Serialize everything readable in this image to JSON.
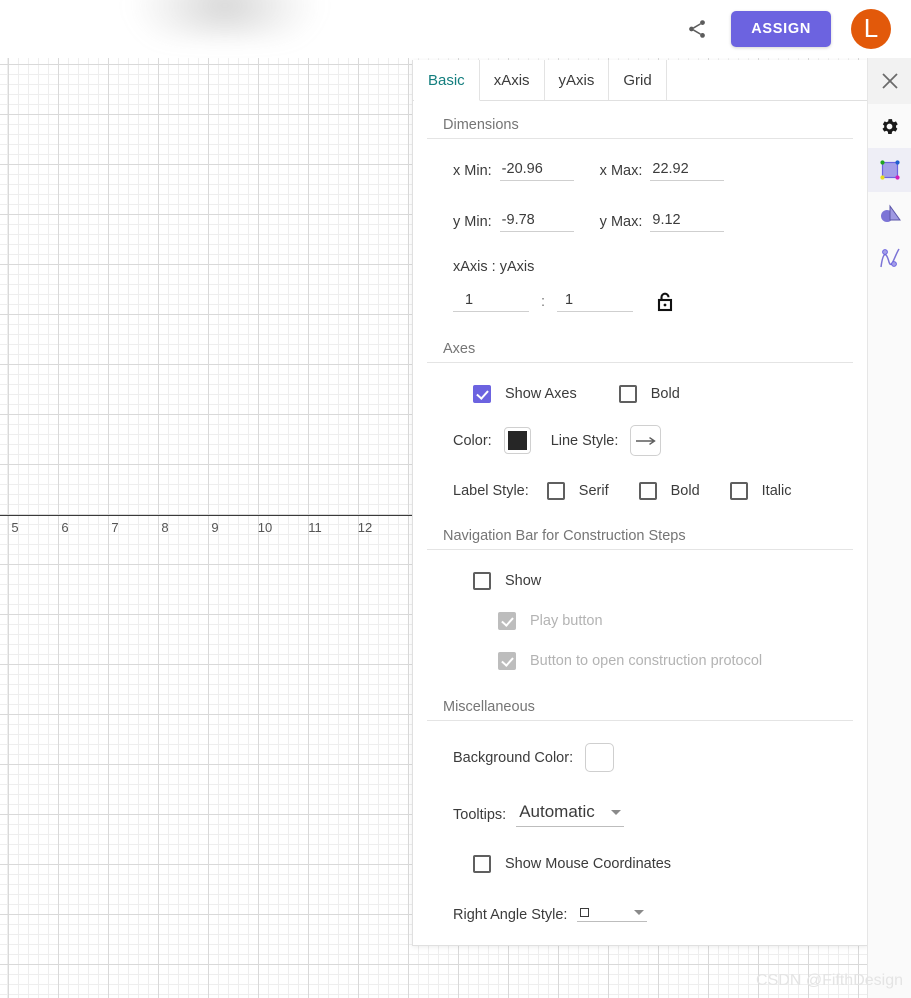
{
  "header": {
    "share_icon": "share-icon",
    "assign_label": "ASSIGN",
    "avatar_initial": "L",
    "assign_color": "#6c63e0",
    "avatar_color": "#e2590a"
  },
  "graphics_view": {
    "axis_tick_labels": [
      "5",
      "6",
      "7",
      "8",
      "9",
      "10",
      "11",
      "12"
    ],
    "grid_minor_color": "#eeeeee",
    "grid_major_color": "#d9d9d9",
    "axis_color": "#3b3b3b"
  },
  "panel": {
    "tabs": [
      {
        "label": "Basic",
        "active": true
      },
      {
        "label": "xAxis",
        "active": false
      },
      {
        "label": "yAxis",
        "active": false
      },
      {
        "label": "Grid",
        "active": false
      }
    ],
    "active_tab_color": "#137e7e",
    "sections": {
      "dimensions": {
        "title": "Dimensions",
        "x_min_label": "x Min:",
        "x_min_value": "-20.96",
        "x_max_label": "x Max:",
        "x_max_value": "22.92",
        "y_min_label": "y Min:",
        "y_min_value": "-9.78",
        "y_max_label": "y Max:",
        "y_max_value": "9.12",
        "ratio_label": "xAxis : yAxis",
        "ratio_x_value": "1",
        "ratio_separator": ":",
        "ratio_y_value": "1",
        "lock_icon": "unlock-icon"
      },
      "axes": {
        "title": "Axes",
        "show_axes_label": "Show Axes",
        "show_axes_checked": true,
        "bold_label": "Bold",
        "bold_checked": false,
        "color_label": "Color:",
        "color_value": "#262626",
        "line_style_label": "Line Style:",
        "line_style_icon": "arrow-right-icon",
        "label_style_label": "Label Style:",
        "serif_label": "Serif",
        "serif_checked": false,
        "label_bold_label": "Bold",
        "label_bold_checked": false,
        "italic_label": "Italic",
        "italic_checked": false
      },
      "navbar": {
        "title": "Navigation Bar for Construction Steps",
        "show_label": "Show",
        "show_checked": false,
        "play_button_label": "Play button",
        "play_button_checked": true,
        "play_button_disabled": true,
        "protocol_label": "Button to open construction protocol",
        "protocol_checked": true,
        "protocol_disabled": true
      },
      "miscellaneous": {
        "title": "Miscellaneous",
        "background_color_label": "Background Color:",
        "background_color_value": "#ffffff",
        "tooltips_label": "Tooltips:",
        "tooltips_value": "Automatic",
        "show_mouse_coordinates_label": "Show Mouse Coordinates",
        "show_mouse_coordinates_checked": false,
        "right_angle_style_label": "Right Angle Style:",
        "right_angle_style_value": "square-glyph"
      }
    }
  },
  "right_toolbar": {
    "close_icon": "close-icon",
    "items": [
      {
        "icon": "gear-icon",
        "name": "settings"
      },
      {
        "icon": "square-with-points-icon",
        "name": "shape-tool"
      },
      {
        "icon": "circle-triangle-icon",
        "name": "shapes-tool"
      },
      {
        "icon": "function-graph-icon",
        "name": "function-tool"
      }
    ]
  },
  "watermark": {
    "text": "CSDN @FifthDesign"
  }
}
